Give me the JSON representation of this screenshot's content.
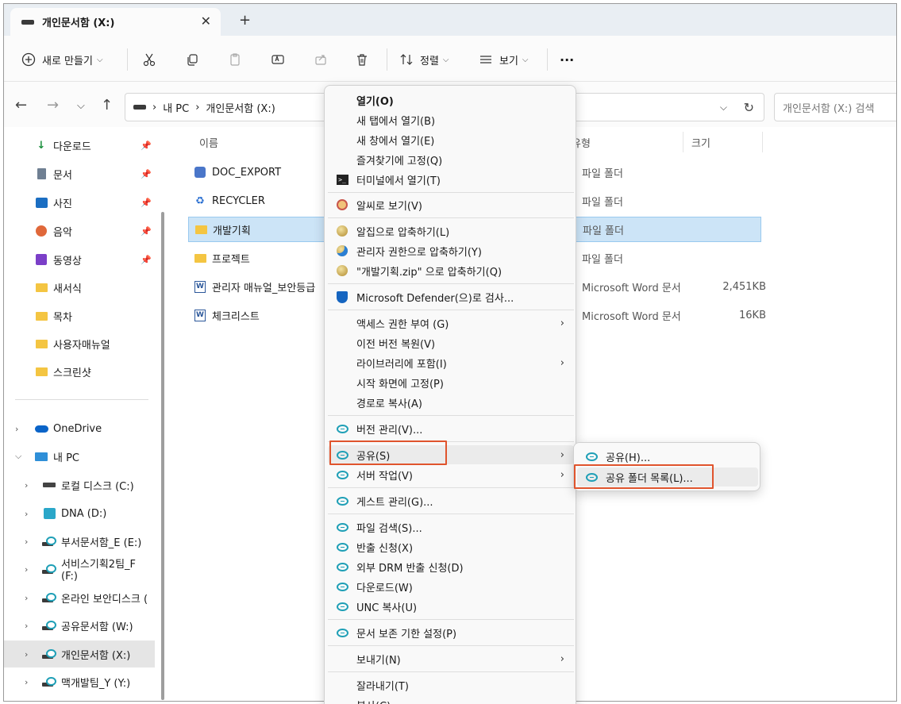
{
  "tab": {
    "title": "개인문서함 (X:)",
    "close": "✕",
    "new": "+"
  },
  "toolbar": {
    "new_label": "새로 만들기",
    "sort_label": "정렬",
    "view_label": "보기",
    "more": "···"
  },
  "address": {
    "crumb_pc": "내 PC",
    "crumb_drive": "개인문서함 (X:)",
    "search_placeholder": "개인문서함 (X:) 검색"
  },
  "sidebar": {
    "quick": [
      {
        "label": "다운로드"
      },
      {
        "label": "문서"
      },
      {
        "label": "사진"
      },
      {
        "label": "음악"
      },
      {
        "label": "동영상"
      },
      {
        "label": "새서식"
      },
      {
        "label": "목차"
      },
      {
        "label": "사용자매뉴얼"
      },
      {
        "label": "스크린샷"
      }
    ],
    "onedrive": "OneDrive",
    "mypc": "내 PC",
    "drives": [
      {
        "label": "로컬 디스크 (C:)"
      },
      {
        "label": "DNA (D:)"
      },
      {
        "label": "부서문서함_E (E:)"
      },
      {
        "label": "서비스기획2팀_F (F:)"
      },
      {
        "label": "온라인 보안디스크 ("
      },
      {
        "label": "공유문서함 (W:)"
      },
      {
        "label": "개인문서함 (X:)"
      },
      {
        "label": "맥개발팀_Y (Y:)"
      }
    ]
  },
  "columns": {
    "name": "이름",
    "type": "유형",
    "size": "크기"
  },
  "files": [
    {
      "name": "DOC_EXPORT",
      "type": "파일 폴더",
      "size": ""
    },
    {
      "name": "RECYCLER",
      "type": "파일 폴더",
      "size": ""
    },
    {
      "name": "개발기획",
      "type": "파일 폴더",
      "size": ""
    },
    {
      "name": "프로젝트",
      "type": "파일 폴더",
      "size": ""
    },
    {
      "name": "관리자 매뉴얼_보안등급",
      "type": "Microsoft Word 문서",
      "size": "2,451KB"
    },
    {
      "name": "체크리스트",
      "type": "Microsoft Word 문서",
      "size": "16KB"
    }
  ],
  "menu": {
    "open": "열기(O)",
    "open_tab": "새 탭에서 열기(B)",
    "open_window": "새 창에서 열기(E)",
    "pin_fav": "즐겨찾기에 고정(Q)",
    "open_terminal": "터미널에서 열기(T)",
    "alsee": "알씨로 보기(V)",
    "alzip": "알집으로 압축하기(L)",
    "alzip_admin": "관리자 권한으로 압축하기(Y)",
    "alzip_named": "\"개발기획.zip\" 으로 압축하기(Q)",
    "defender": "Microsoft Defender(으)로 검사...",
    "grant_access": "액세스 권한 부여 (G)",
    "restore_prev": "이전 버전 복원(V)",
    "include_library": "라이브러리에 포함(I)",
    "pin_start": "시작 화면에 고정(P)",
    "copy_path": "경로로 복사(A)",
    "version": "버전 관리(V)...",
    "share": "공유(S)",
    "server_task": "서버 작업(V)",
    "guest": "게스트 관리(G)...",
    "file_search": "파일 검색(S)...",
    "export_req": "반출 신청(X)",
    "drm_req": "외부 DRM 반출 신청(D)",
    "download": "다운로드(W)",
    "unc_copy": "UNC 복사(U)",
    "retention": "문서 보존 기한 설정(P)",
    "send_to": "보내기(N)",
    "cut": "잘라내기(T)",
    "copy": "복사(C)"
  },
  "submenu": {
    "share_h": "공유(H)...",
    "share_list": "공유 폴더 목록(L)..."
  },
  "colors": {
    "accent_box": "#e0542d",
    "selected_row": "#cce4f7",
    "folder": "#f4c542",
    "doc_icon": "#1e9fb6"
  }
}
